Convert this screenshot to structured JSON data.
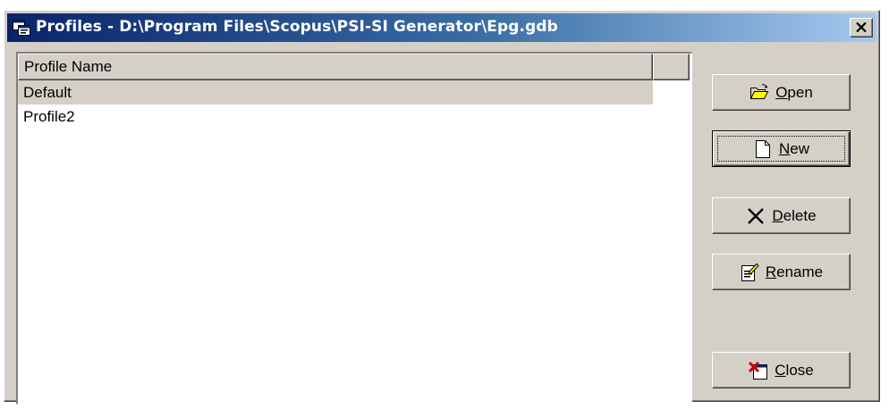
{
  "window": {
    "title": "Profiles - D:\\Program Files\\Scopus\\PSI-SI Generator\\Epg.gdb"
  },
  "list": {
    "column_header": "Profile Name",
    "rows": [
      "Default",
      "Profile2"
    ],
    "selected_index": 0
  },
  "buttons": {
    "open": {
      "mnemonic": "O",
      "rest": "pen"
    },
    "new": {
      "mnemonic": "N",
      "rest": "ew"
    },
    "delete": {
      "mnemonic": "D",
      "rest": "elete"
    },
    "rename": {
      "mnemonic": "R",
      "rest": "ename"
    },
    "close": {
      "mnemonic": "C",
      "rest": "lose"
    }
  },
  "icons": {
    "title": "profiles-app-icon",
    "open": "folder-open-icon",
    "new": "new-document-icon",
    "delete": "delete-x-icon",
    "rename": "rename-edit-icon",
    "close": "close-door-icon"
  },
  "colors": {
    "titlebar_start": "#0a246a",
    "titlebar_end": "#a6caf0",
    "face": "#d4d0c8"
  }
}
